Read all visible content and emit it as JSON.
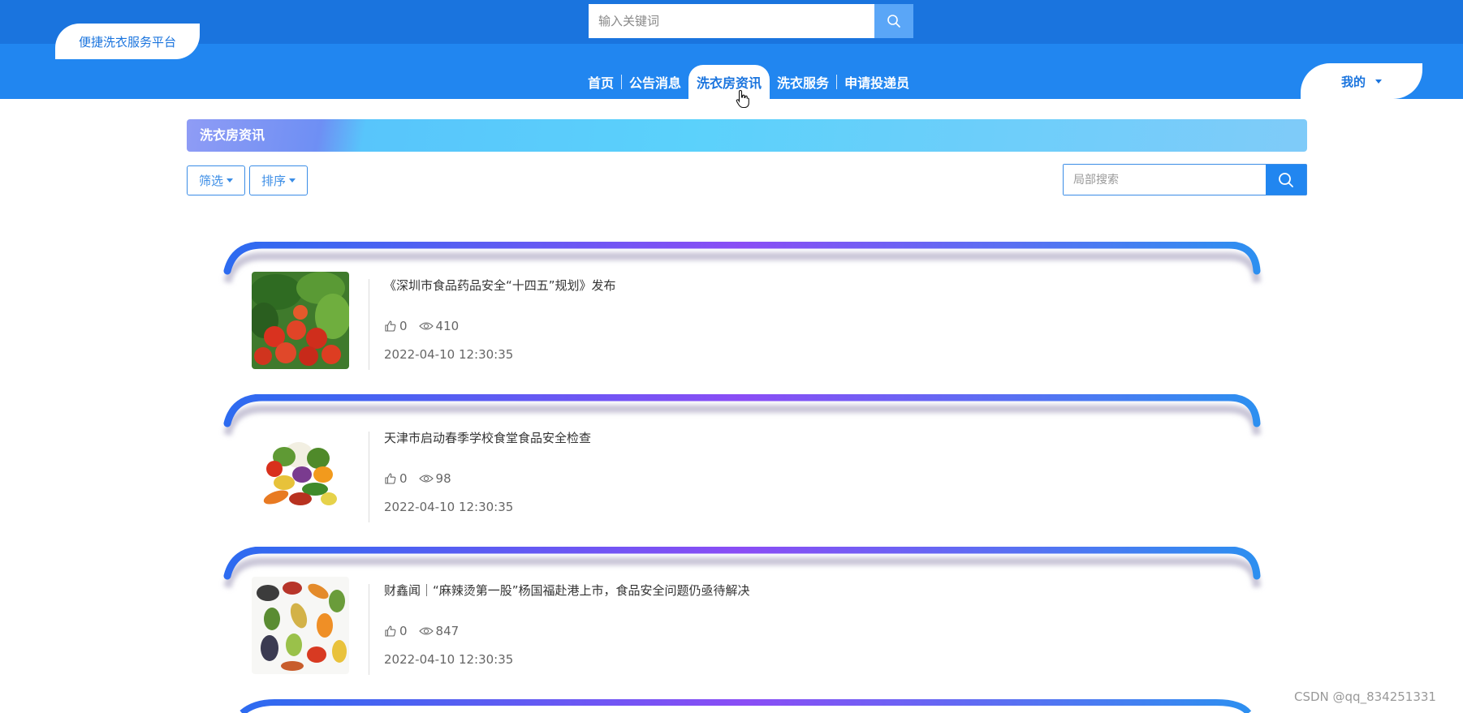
{
  "header": {
    "logo_text": "便捷洗衣服务平台",
    "search_placeholder": "输入关键词"
  },
  "nav": {
    "items": [
      {
        "label": "首页",
        "active": false
      },
      {
        "label": "公告消息",
        "active": false
      },
      {
        "label": "洗衣房资讯",
        "active": true
      },
      {
        "label": "洗衣服务",
        "active": false
      },
      {
        "label": "申请投递员",
        "active": false
      }
    ],
    "user_menu_label": "我的"
  },
  "section": {
    "title": "洗衣房资讯"
  },
  "filters": {
    "filter_label": "筛选",
    "sort_label": "排序",
    "local_search_placeholder": "局部搜索"
  },
  "news": [
    {
      "title": "《深圳市食品药品安全“十四五”规划》发布",
      "likes": "0",
      "views": "410",
      "time": "2022-04-10 12:30:35",
      "thumb": "vegetables-red-green"
    },
    {
      "title": "天津市启动春季学校食堂食品安全检查",
      "likes": "0",
      "views": "98",
      "time": "2022-04-10 12:30:35",
      "thumb": "vegetable-pile"
    },
    {
      "title": "财鑫闻｜“麻辣烫第一股”杨国福赴港上市，食品安全问题仍亟待解决",
      "likes": "0",
      "views": "847",
      "time": "2022-04-10 12:30:35",
      "thumb": "vegetable-flatlay"
    }
  ],
  "watermark": "CSDN @qq_834251331",
  "colors": {
    "primary": "#2186f0",
    "topbar": "#1a74de",
    "accent": "#3b8de6"
  }
}
